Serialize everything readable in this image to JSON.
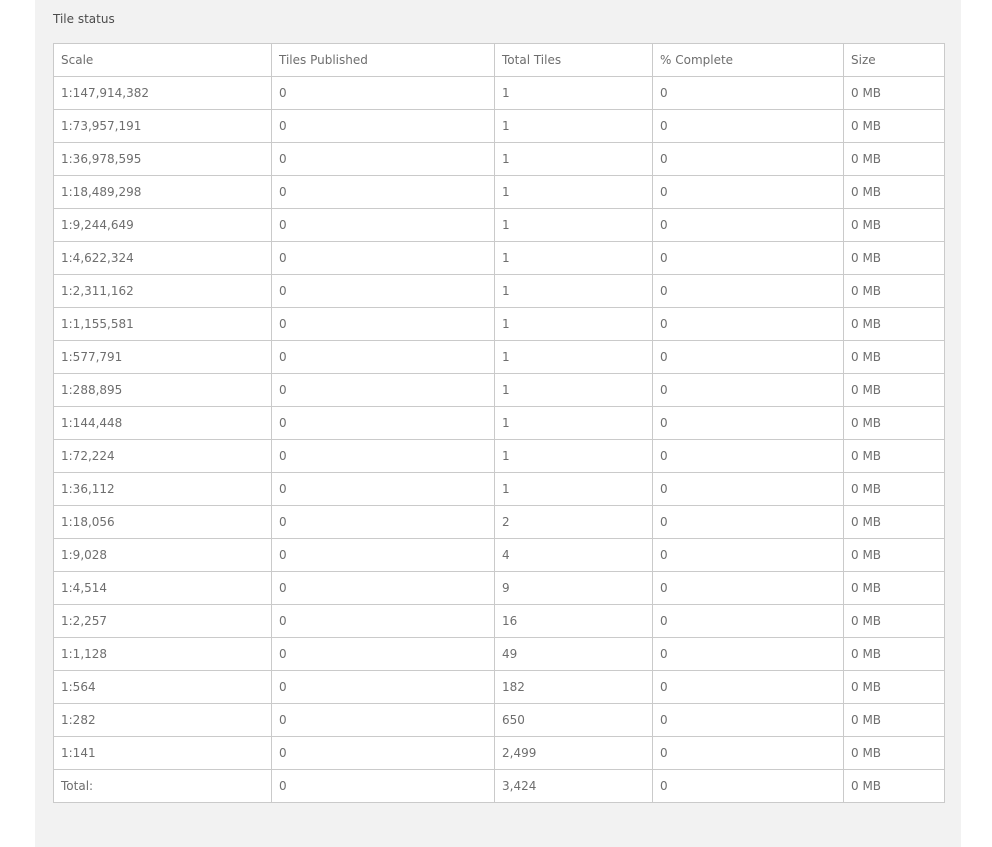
{
  "section_title": "Tile status",
  "columns": [
    "Scale",
    "Tiles Published",
    "Total Tiles",
    "% Complete",
    "Size"
  ],
  "rows": [
    [
      "1:147,914,382",
      "0",
      "1",
      "0",
      "0 MB"
    ],
    [
      "1:73,957,191",
      "0",
      "1",
      "0",
      "0 MB"
    ],
    [
      "1:36,978,595",
      "0",
      "1",
      "0",
      "0 MB"
    ],
    [
      "1:18,489,298",
      "0",
      "1",
      "0",
      "0 MB"
    ],
    [
      "1:9,244,649",
      "0",
      "1",
      "0",
      "0 MB"
    ],
    [
      "1:4,622,324",
      "0",
      "1",
      "0",
      "0 MB"
    ],
    [
      "1:2,311,162",
      "0",
      "1",
      "0",
      "0 MB"
    ],
    [
      "1:1,155,581",
      "0",
      "1",
      "0",
      "0 MB"
    ],
    [
      "1:577,791",
      "0",
      "1",
      "0",
      "0 MB"
    ],
    [
      "1:288,895",
      "0",
      "1",
      "0",
      "0 MB"
    ],
    [
      "1:144,448",
      "0",
      "1",
      "0",
      "0 MB"
    ],
    [
      "1:72,224",
      "0",
      "1",
      "0",
      "0 MB"
    ],
    [
      "1:36,112",
      "0",
      "1",
      "0",
      "0 MB"
    ],
    [
      "1:18,056",
      "0",
      "2",
      "0",
      "0 MB"
    ],
    [
      "1:9,028",
      "0",
      "4",
      "0",
      "0 MB"
    ],
    [
      "1:4,514",
      "0",
      "9",
      "0",
      "0 MB"
    ],
    [
      "1:2,257",
      "0",
      "16",
      "0",
      "0 MB"
    ],
    [
      "1:1,128",
      "0",
      "49",
      "0",
      "0 MB"
    ],
    [
      "1:564",
      "0",
      "182",
      "0",
      "0 MB"
    ],
    [
      "1:282",
      "0",
      "650",
      "0",
      "0 MB"
    ],
    [
      "1:141",
      "0",
      "2,499",
      "0",
      "0 MB"
    ]
  ],
  "total_row": [
    "Total:",
    "0",
    "3,424",
    "0",
    "0 MB"
  ]
}
